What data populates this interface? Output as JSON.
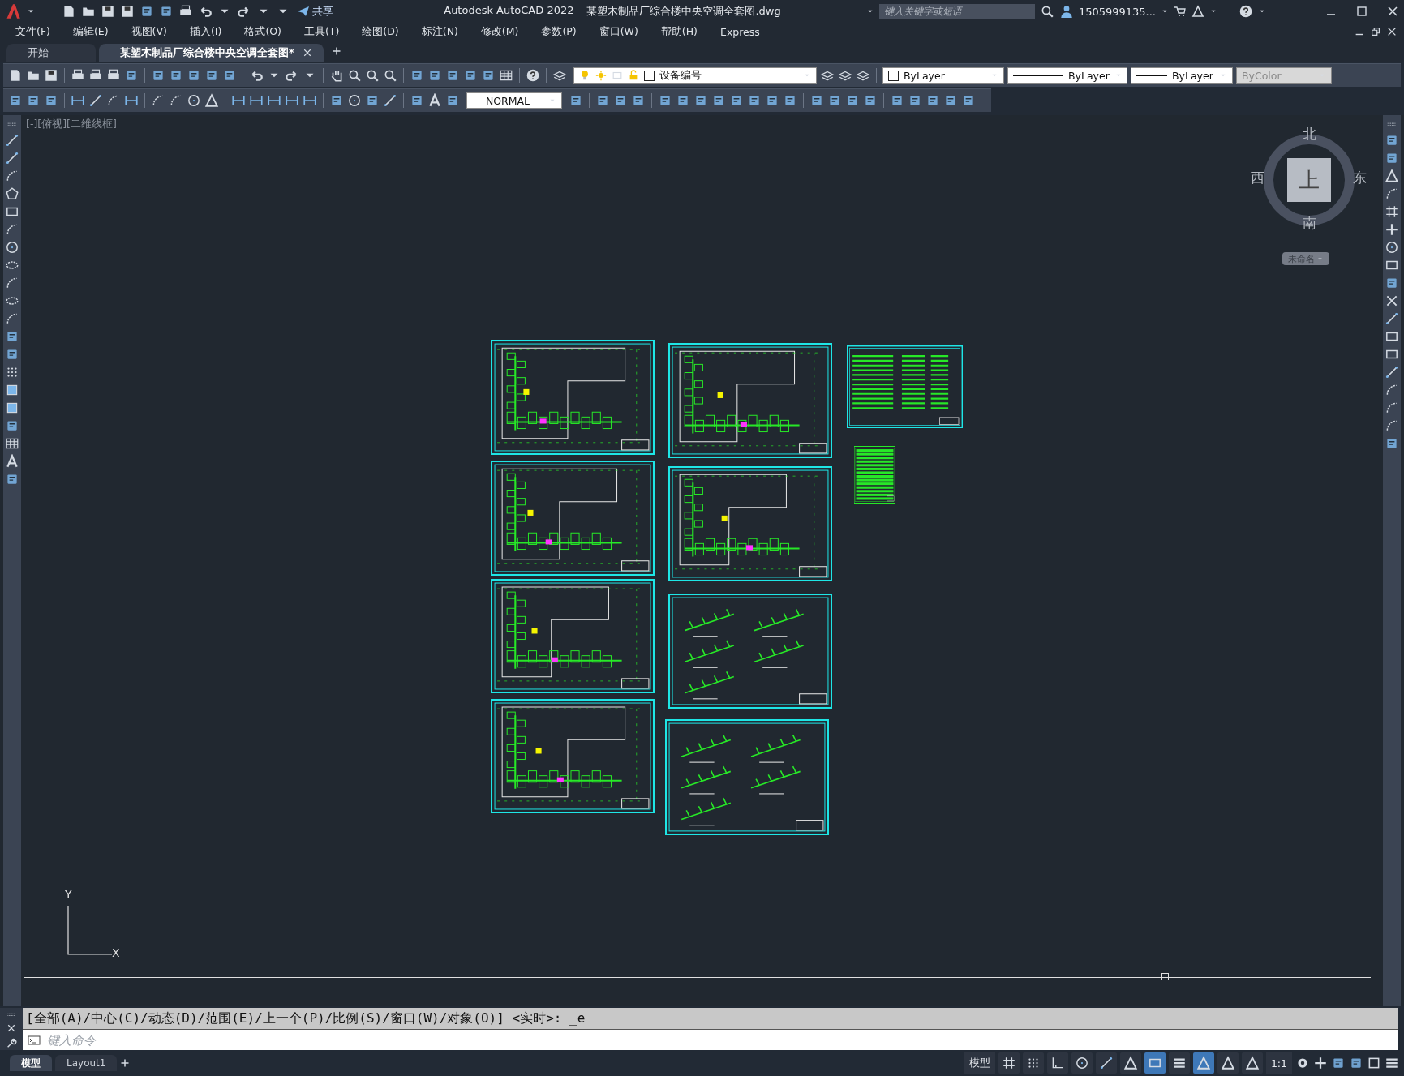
{
  "title_bar": {
    "share": "共享",
    "app_name": "Autodesk AutoCAD 2022",
    "file_name": "某塑木制品厂综合楼中央空调全套图.dwg",
    "search_placeholder": "键入关键字或短语",
    "user": "1505999135..."
  },
  "menu": [
    "文件(F)",
    "编辑(E)",
    "视图(V)",
    "插入(I)",
    "格式(O)",
    "工具(T)",
    "绘图(D)",
    "标注(N)",
    "修改(M)",
    "参数(P)",
    "窗口(W)",
    "帮助(H)",
    "Express"
  ],
  "file_tabs": [
    {
      "label": "开始",
      "selected": false
    },
    {
      "label": "某塑木制品厂综合楼中央空调全套图*",
      "selected": true
    }
  ],
  "toolbar": {
    "layer": "设备编号",
    "color_setting": "ByLayer",
    "linetype": "ByLayer",
    "lineweight": "ByLayer",
    "plot_style": "ByColor",
    "plot_style_disabled": true,
    "dim_style": "NORMAL"
  },
  "viewport": {
    "label": "[-][俯视][二维线框]",
    "viewcube": {
      "north": "北",
      "south": "南",
      "west": "西",
      "east": "东",
      "face": "上",
      "ucs_menu": "未命名"
    },
    "ucs": {
      "x": "X",
      "y": "Y"
    }
  },
  "command": {
    "history": "[全部(A)/中心(C)/动态(D)/范围(E)/上一个(P)/比例(S)/窗口(W)/对象(O)] <实时>: _e",
    "placeholder": "键入命令"
  },
  "layout_tabs": [
    {
      "label": "模型",
      "selected": true
    },
    {
      "label": "Layout1",
      "selected": false
    }
  ],
  "status_bar": {
    "space": "模型",
    "scale": "1:1",
    "toggles": [
      {
        "kind": "grid",
        "on": false
      },
      {
        "kind": "snap",
        "on": false
      },
      {
        "kind": "ortho",
        "on": false
      },
      {
        "kind": "polar",
        "on": false
      },
      {
        "kind": "osnap-track",
        "on": false
      },
      {
        "kind": "isodraft",
        "on": false
      },
      {
        "kind": "osnap",
        "on": true
      },
      {
        "kind": "lineweight",
        "on": false
      },
      {
        "kind": "annotation-visibility",
        "on": true
      },
      {
        "kind": "auto-scale",
        "on": false
      },
      {
        "kind": "annotation-scale",
        "on": false
      }
    ]
  }
}
